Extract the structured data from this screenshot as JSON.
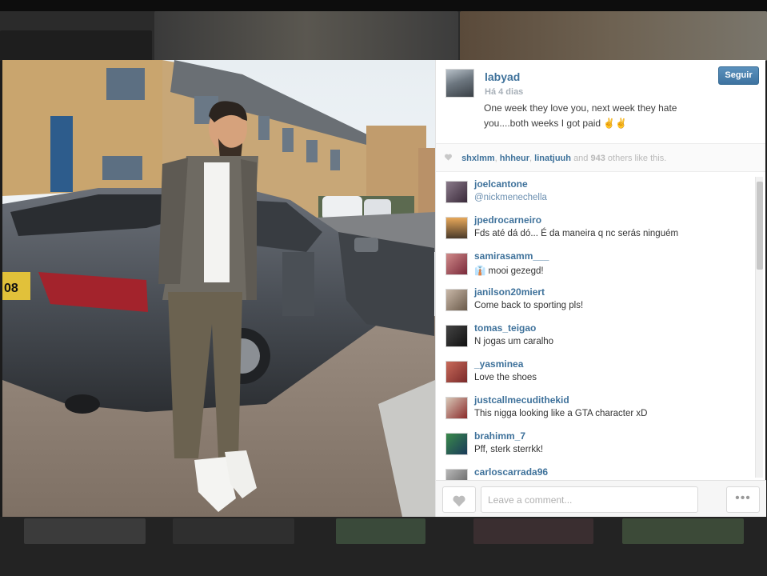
{
  "post": {
    "owner": "labyad",
    "time": "Há 4 dias",
    "caption": "One week they love you, next week they hate you....both weeks I got paid ✌✌",
    "follow_label": "Seguir"
  },
  "likes": {
    "users": [
      "shxlmm",
      "hhheur",
      "linatjuuh"
    ],
    "and_text": "and",
    "count": "943",
    "suffix": "others like this."
  },
  "comments": [
    {
      "user": "joelcantone",
      "text": "@nickmenechella",
      "mention": true
    },
    {
      "user": "jpedrocarneiro",
      "text": "Fds até dá dó... É da maneira q nc serás ninguém"
    },
    {
      "user": "samirasamm___",
      "text": "👔 mooi gezegd!"
    },
    {
      "user": "janilson20miert",
      "text": "Come back to sporting pls!"
    },
    {
      "user": "tomas_teigao",
      "text": "N jogas um caralho"
    },
    {
      "user": "_yasminea",
      "text": "Love the shoes"
    },
    {
      "user": "justcallmecudithekid",
      "text": "This nigga looking like a GTA character xD"
    },
    {
      "user": "brahimm_7",
      "text": "Pff, sterk sterrkk!"
    },
    {
      "user": "carloscarrada96",
      "text": ""
    }
  ],
  "footer": {
    "comment_placeholder": "Leave a comment...",
    "more_label": "•••"
  },
  "icons": {
    "like": "heart-icon",
    "more": "ellipsis-icon"
  },
  "colors": {
    "username": "#3f729b",
    "follow_button": "#4a80ad"
  }
}
